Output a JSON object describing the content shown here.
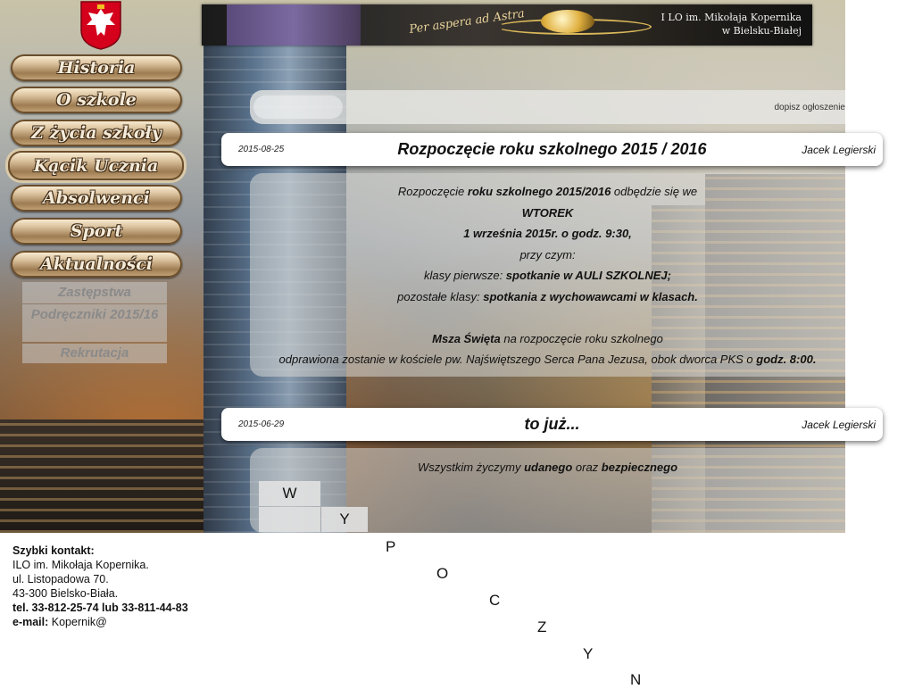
{
  "banner": {
    "motto": "Per aspera ad Astra",
    "school_line1": "I LO im. Mikołaja Kopernika",
    "school_line2": "w Bielsku-Białej"
  },
  "nav": {
    "items": [
      {
        "label": "Historia"
      },
      {
        "label": "O szkole"
      },
      {
        "label": "Z życia szkoły"
      },
      {
        "label": "Kącik Ucznia"
      },
      {
        "label": "Absolwenci"
      },
      {
        "label": "Sport"
      },
      {
        "label": "Aktualności"
      }
    ],
    "subitems": [
      {
        "label": "Zastępstwa"
      },
      {
        "label": "Podręczniki 2015/16"
      },
      {
        "label": "Rekrutacja"
      }
    ]
  },
  "ads": {
    "link_label": "dopisz ogłoszenie"
  },
  "posts": [
    {
      "date": "2015-08-25",
      "title": "Rozpoczęcie roku szkolnego 2015 / 2016",
      "author": "Jacek Legierski",
      "body": {
        "l1a": "Rozpoczęcie ",
        "l1b": "roku szkolnego 2015/2016",
        "l1c": " odbędzie się we",
        "l2": "WTOREK",
        "l3": "1 września 2015r. o godz. 9:30,",
        "l4": "przy czym:",
        "l5a": "klasy pierwsze: ",
        "l5b": "spotkanie w AULI SZKOLNEJ;",
        "l6a": "pozostałe klasy: ",
        "l6b": "spotkania z wychowawcami w klasach.",
        "l7a": "Msza Święta",
        "l7b": " na rozpoczęcie roku szkolnego",
        "l8a": "odprawiona zostanie w kościele pw. Najświętszego Serca Pana Jezusa, obok dworca PKS o ",
        "l8b": "godz. 8:00."
      }
    },
    {
      "date": "2015-06-29",
      "title": "to już...",
      "author": "Jacek Legierski",
      "body": {
        "l1a": "Wszystkim życzymy ",
        "l1b": "udanego",
        "l1c": " oraz ",
        "l1d": "bezpiecznego",
        "letters": [
          "W",
          "Y",
          "P",
          "O",
          "C",
          "Z",
          "Y",
          "N"
        ]
      }
    }
  ],
  "contact": {
    "heading": "Szybki kontakt:",
    "name": "ILO im. Mikołaja Kopernika.",
    "street": "ul. Listopadowa 70.",
    "city": "43-300 Bielsko-Biała.",
    "phone": "tel. 33-812-25-74 lub 33-811-44-83",
    "email_label": "e-mail:",
    "email_value": " Kopernik@"
  },
  "colors": {
    "nav_text": "#f4ead8",
    "nav_outline": "#3e2a15",
    "card_bg": "#ffffff"
  }
}
